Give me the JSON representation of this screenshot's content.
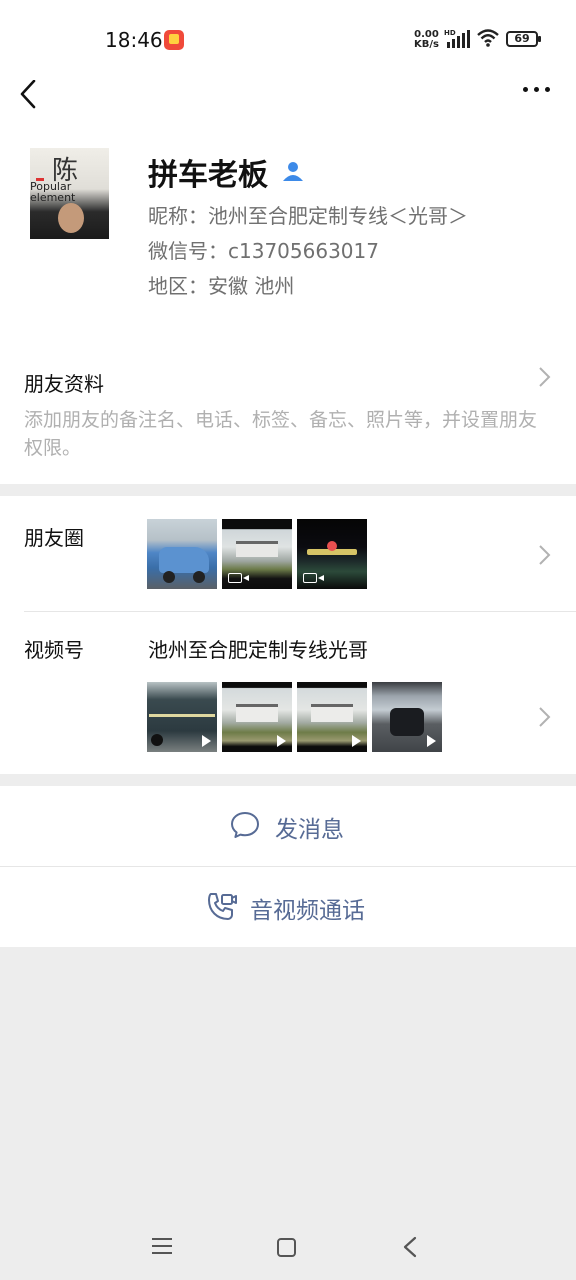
{
  "status_bar": {
    "time": "18:46",
    "net_speed_value": "0.00",
    "net_speed_unit": "KB/s",
    "hd_label": "HD",
    "battery": "69"
  },
  "nav": {
    "back_icon": "chevron-left-icon",
    "more_icon": "more-dots-icon"
  },
  "profile": {
    "avatar_text_glyph": "陈",
    "avatar_text_1": "Popular",
    "avatar_text_2": "element",
    "name": "拼车老板",
    "nickname": "昵称：池州至合肥定制专线＜光哥＞",
    "wechat_id": "微信号：c13705663017",
    "region": "地区：安徽 池州"
  },
  "friend_info": {
    "title": "朋友资料",
    "desc": "添加朋友的备注名、电话、标签、备忘、照片等，并设置朋友权限。"
  },
  "moments": {
    "label": "朋友圈",
    "thumbs": [
      {
        "type": "image",
        "desc": "blue car"
      },
      {
        "type": "video",
        "desc": "building"
      },
      {
        "type": "video",
        "desc": "night"
      }
    ]
  },
  "channels": {
    "label": "视频号",
    "name": "池州至合肥定制专线光哥",
    "thumbs": [
      {
        "type": "video"
      },
      {
        "type": "video"
      },
      {
        "type": "video"
      },
      {
        "type": "video"
      }
    ]
  },
  "actions": {
    "send_message": "发消息",
    "av_call": "音视频通话"
  },
  "colors": {
    "link_blue": "#576b95",
    "background": "#ededed"
  }
}
